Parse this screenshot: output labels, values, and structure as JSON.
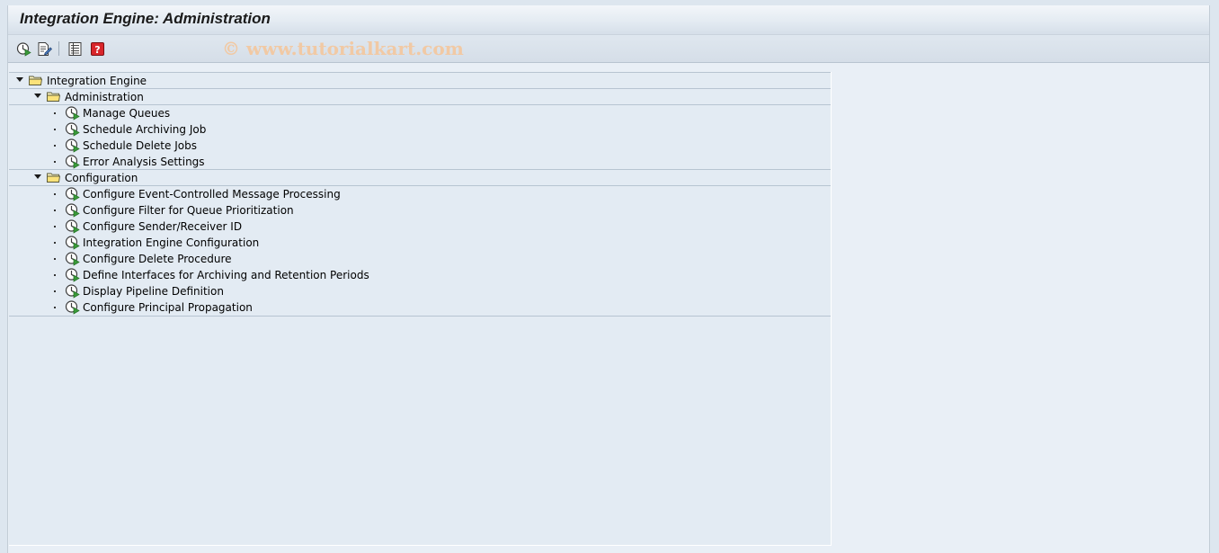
{
  "window": {
    "title": "Integration Engine: Administration"
  },
  "toolbar": {
    "watermark": "© www.tutorialkart.com",
    "buttons": [
      {
        "icon": "execute-icon"
      },
      {
        "icon": "edit-document-icon"
      },
      {
        "icon": "list-icon"
      },
      {
        "icon": "help-icon"
      }
    ]
  },
  "tree": {
    "root": {
      "label": "Integration Engine"
    },
    "administration": {
      "label": "Administration",
      "items": [
        {
          "label": "Manage Queues"
        },
        {
          "label": "Schedule Archiving Job"
        },
        {
          "label": "Schedule Delete Jobs"
        },
        {
          "label": "Error Analysis Settings"
        }
      ]
    },
    "configuration": {
      "label": "Configuration",
      "items": [
        {
          "label": "Configure Event-Controlled Message Processing"
        },
        {
          "label": "Configure Filter for Queue Prioritization"
        },
        {
          "label": "Configure Sender/Receiver ID"
        },
        {
          "label": "Integration Engine Configuration"
        },
        {
          "label": "Configure Delete Procedure"
        },
        {
          "label": "Define Interfaces for Archiving and Retention Periods"
        },
        {
          "label": "Display Pipeline Definition"
        },
        {
          "label": "Configure Principal Propagation"
        }
      ]
    }
  },
  "colors": {
    "background": "#e9eff6",
    "tree_background": "#e3ebf3",
    "watermark": "#f1c9a4",
    "exec_icon_green": "#3a9a3a"
  }
}
